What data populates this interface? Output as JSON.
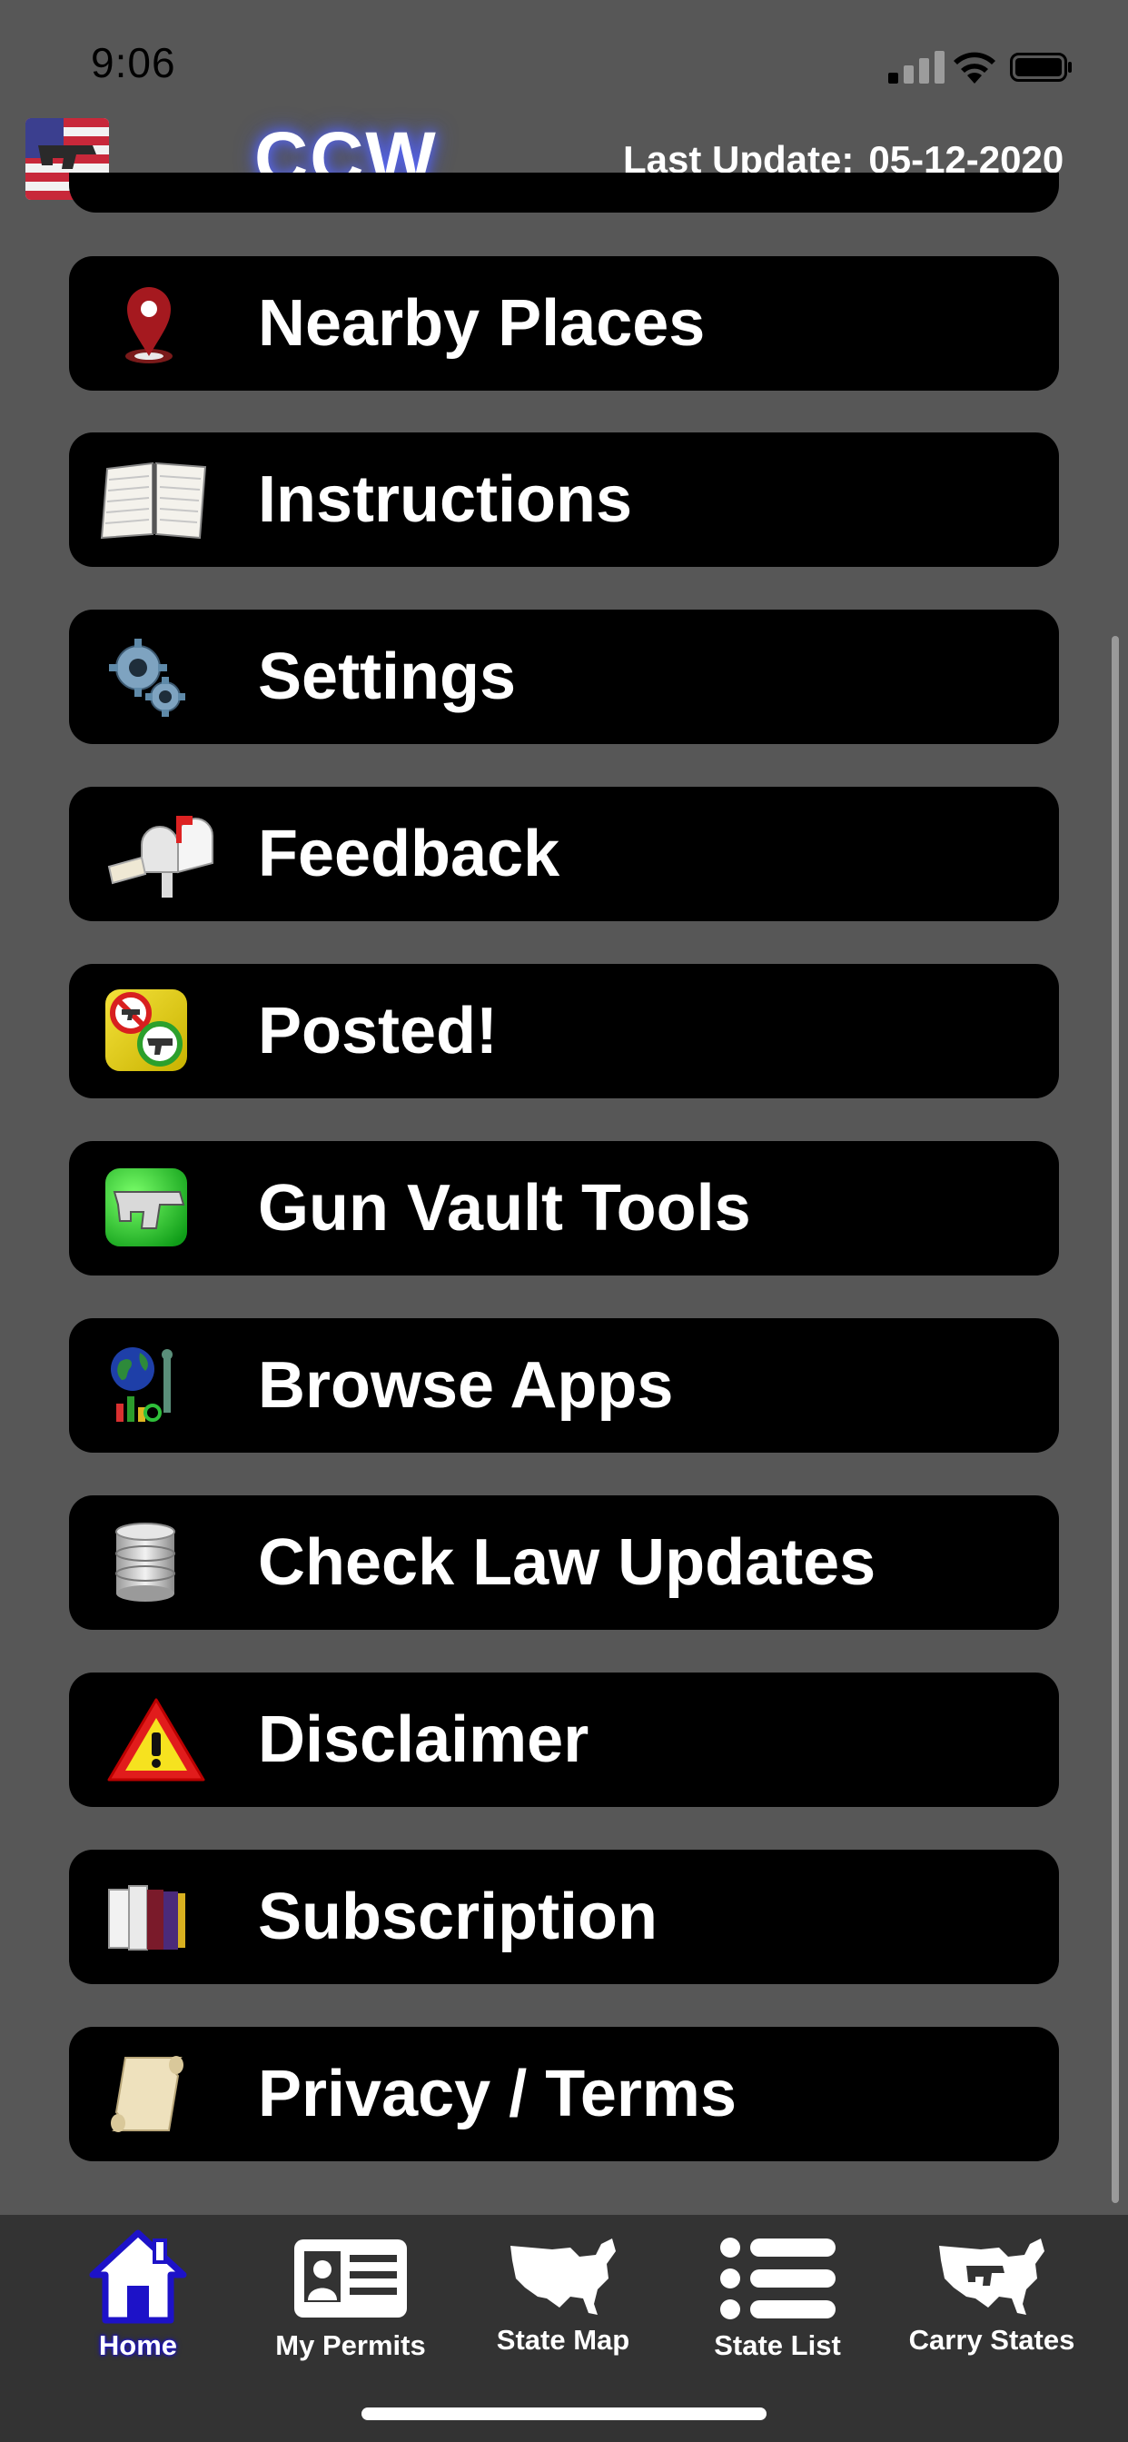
{
  "status_bar": {
    "time": "9:06"
  },
  "header": {
    "title": "CCW",
    "last_update_label": "Last Update:",
    "last_update_date": "05-12-2020"
  },
  "menu": {
    "items": [
      {
        "label": "Nearby Places",
        "icon": "map-pin-icon"
      },
      {
        "label": "Instructions",
        "icon": "notebook-icon"
      },
      {
        "label": "Settings",
        "icon": "gears-icon"
      },
      {
        "label": "Feedback",
        "icon": "mailbox-icon"
      },
      {
        "label": "Posted!",
        "icon": "posted-sign-icon"
      },
      {
        "label": "Gun Vault Tools",
        "icon": "gun-vault-icon"
      },
      {
        "label": "Browse Apps",
        "icon": "globe-apps-icon"
      },
      {
        "label": "Check Law Updates",
        "icon": "database-icon"
      },
      {
        "label": "Disclaimer",
        "icon": "warning-icon"
      },
      {
        "label": "Subscription",
        "icon": "books-icon"
      },
      {
        "label": "Privacy / Terms",
        "icon": "scroll-icon"
      }
    ]
  },
  "tabs": [
    {
      "label": "Home",
      "icon": "home-icon",
      "active": true
    },
    {
      "label": "My Permits",
      "icon": "id-card-icon",
      "active": false
    },
    {
      "label": "State Map",
      "icon": "us-map-icon",
      "active": false
    },
    {
      "label": "State List",
      "icon": "list-icon",
      "active": false
    },
    {
      "label": "Carry States",
      "icon": "us-map-gun-icon",
      "active": false
    }
  ],
  "colors": {
    "background": "#575757",
    "menu_item": "#000000",
    "tab_bar": "#333333",
    "active_tab_glow": "#1d12c8",
    "title_glow": "#5c6cff"
  }
}
